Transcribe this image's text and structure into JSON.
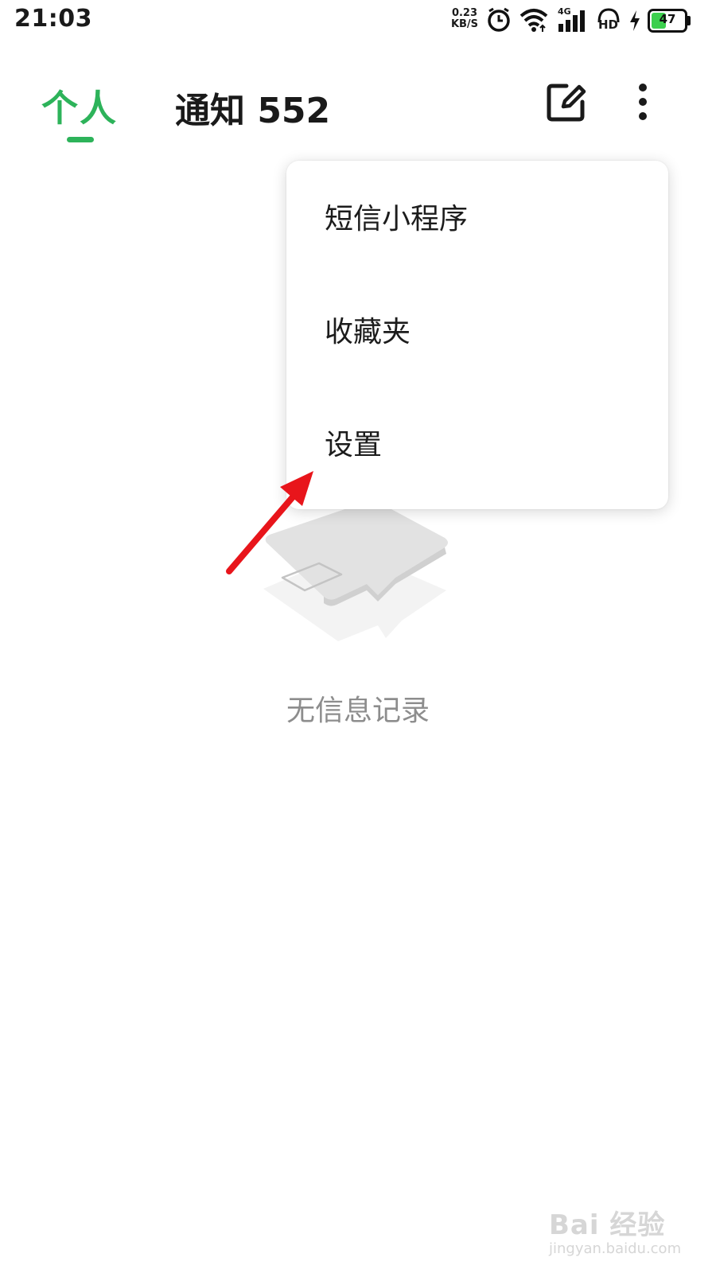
{
  "status_bar": {
    "time": "21:03",
    "net_speed_value": "0.23",
    "net_speed_unit": "KB/S",
    "network_type": "4G",
    "hd_label": "HD",
    "battery": "47",
    "icons": [
      "alarm-icon",
      "wifi-icon",
      "signal-icon",
      "hd-icon",
      "charging-icon",
      "battery-icon"
    ]
  },
  "header": {
    "tab_personal": "个人",
    "tab_notify": "通知 552",
    "compose_icon": "compose-icon",
    "more_icon": "more-vertical-icon",
    "accent_color": "#2db35a"
  },
  "menu": {
    "items": [
      {
        "label": "短信小程序"
      },
      {
        "label": "收藏夹"
      },
      {
        "label": "设置"
      }
    ]
  },
  "empty_state": {
    "icon": "empty-message-icon",
    "text": "无信息记录"
  },
  "annotation": {
    "icon": "red-arrow-icon",
    "color": "#e8151b"
  },
  "watermark": {
    "brand": "Bai 经验",
    "url": "jingyan.baidu.com"
  }
}
